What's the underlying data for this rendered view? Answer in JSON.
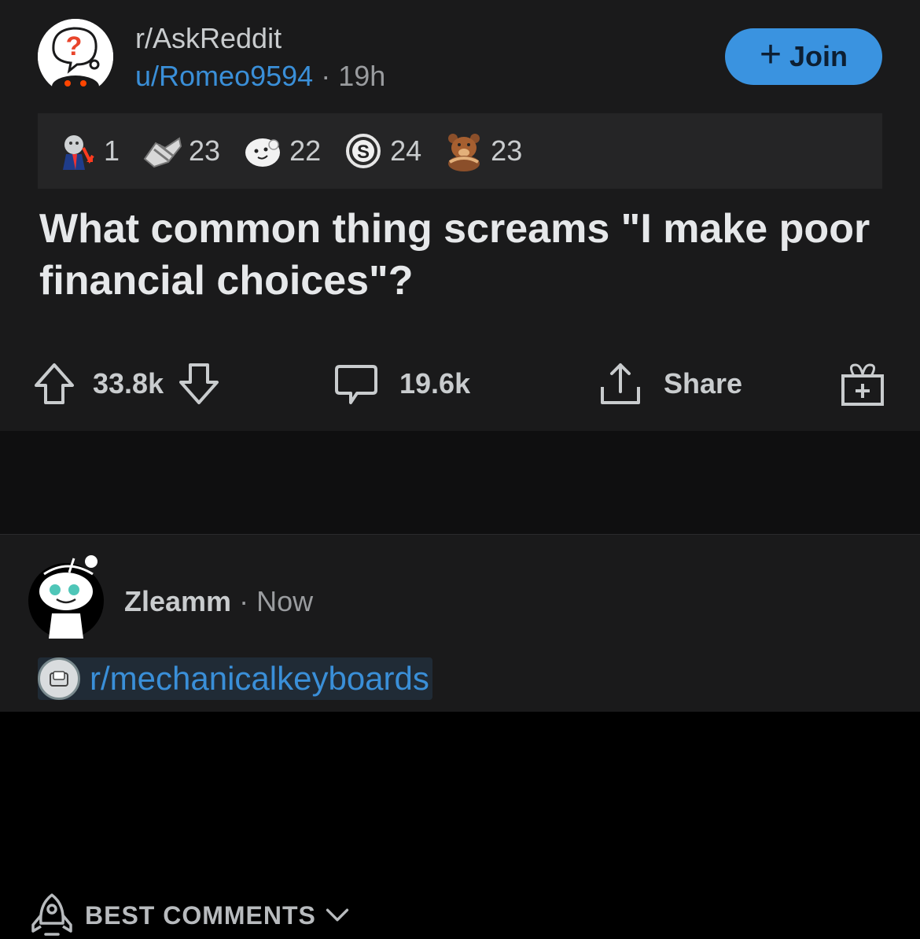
{
  "post": {
    "subreddit": "r/AskReddit",
    "author": "u/Romeo9594",
    "separator": "·",
    "age": "19h",
    "join_label": "Join",
    "join_icon": "plus-icon",
    "accent_color": "#3a93e0",
    "awards": [
      {
        "icon": "stonks-falling-award-icon",
        "count": "1"
      },
      {
        "icon": "bravo-handshake-award-icon",
        "count": "23"
      },
      {
        "icon": "wholesome-seal-award-icon",
        "count": "22"
      },
      {
        "icon": "silver-award-icon",
        "count": "24"
      },
      {
        "icon": "bear-hug-award-icon",
        "count": "23"
      }
    ],
    "title": "What common thing screams \"I make poor financial choices\"?"
  },
  "actions": {
    "upvotes": "33.8k",
    "comments": "19.6k",
    "share": "Share"
  },
  "sort": {
    "label": "BEST COMMENTS"
  },
  "comment": {
    "username": "Zleamm",
    "separator": "·",
    "time": "Now",
    "link": "r/mechanicalkeyboards",
    "link_color": "#3a8fd8"
  }
}
